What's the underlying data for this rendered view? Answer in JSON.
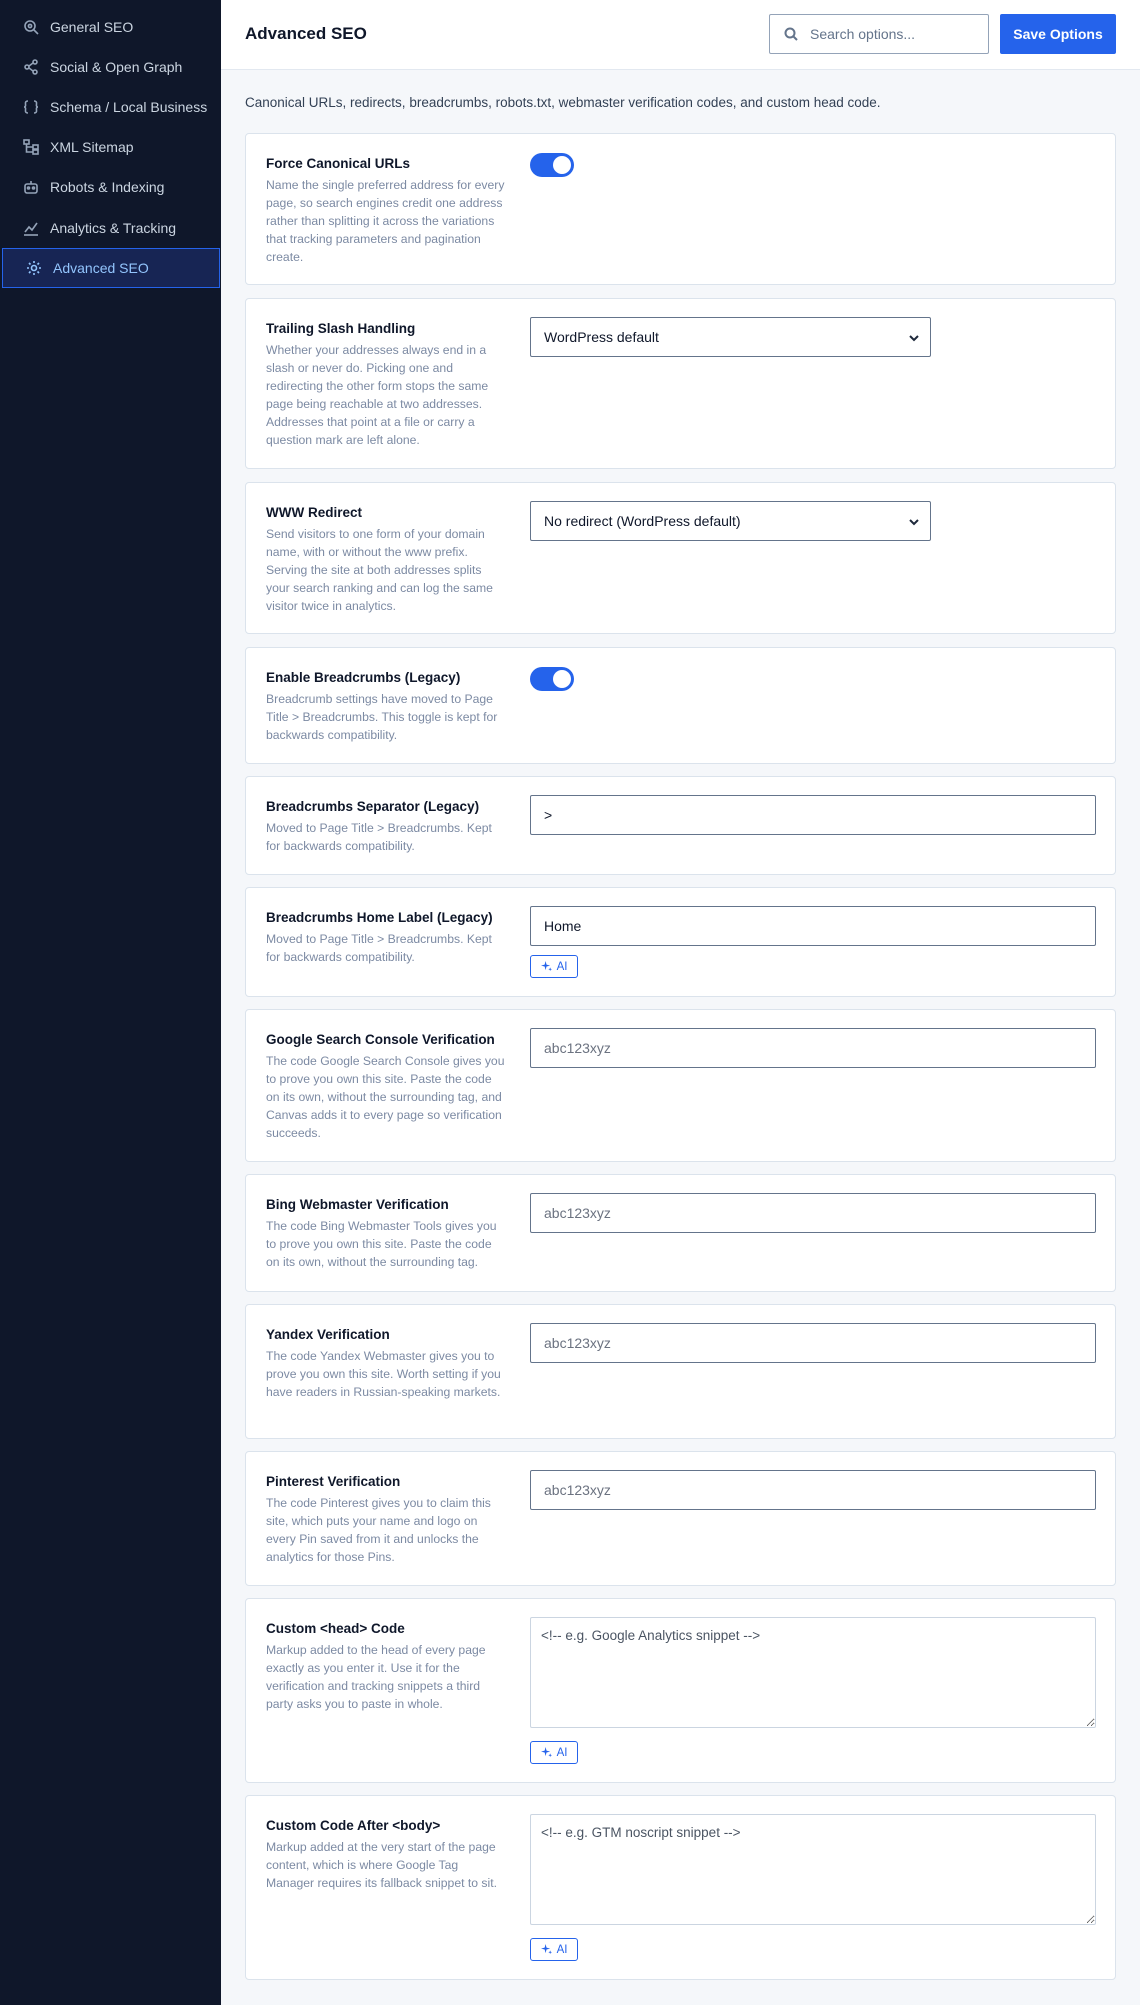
{
  "sidebar": {
    "items": [
      {
        "label": "General SEO",
        "icon": "search-gear-icon"
      },
      {
        "label": "Social & Open Graph",
        "icon": "share-icon"
      },
      {
        "label": "Schema / Local Business",
        "icon": "braces-icon"
      },
      {
        "label": "XML Sitemap",
        "icon": "sitemap-icon"
      },
      {
        "label": "Robots & Indexing",
        "icon": "robot-icon"
      },
      {
        "label": "Analytics & Tracking",
        "icon": "chart-icon"
      },
      {
        "label": "Advanced SEO",
        "icon": "gear-icon",
        "active": true
      }
    ]
  },
  "header": {
    "title": "Advanced SEO",
    "search_placeholder": "Search options...",
    "save_label": "Save Options"
  },
  "intro": "Canonical URLs, redirects, breadcrumbs, robots.txt, webmaster verification codes, and custom head code.",
  "settings": {
    "force_canonical": {
      "label": "Force Canonical URLs",
      "description": "Name the single preferred address for every page, so search engines credit one address rather than splitting it across the variations that tracking parameters and pagination create.",
      "enabled": true
    },
    "trailing_slash": {
      "label": "Trailing Slash Handling",
      "description": "Whether your addresses always end in a slash or never do. Picking one and redirecting the other form stops the same page being reachable at two addresses. Addresses that point at a file or carry a question mark are left alone.",
      "value": "WordPress default"
    },
    "www_redirect": {
      "label": "WWW Redirect",
      "description": "Send visitors to one form of your domain name, with or without the www prefix. Serving the site at both addresses splits your search ranking and can log the same visitor twice in analytics.",
      "value": "No redirect (WordPress default)"
    },
    "breadcrumbs": {
      "label": "Enable Breadcrumbs (Legacy)",
      "description": "Breadcrumb settings have moved to Page Title > Breadcrumbs. This toggle is kept for backwards compatibility.",
      "enabled": true
    },
    "breadcrumbs_separator": {
      "label": "Breadcrumbs Separator (Legacy)",
      "description": "Moved to Page Title > Breadcrumbs. Kept for backwards compatibility.",
      "value": ">"
    },
    "breadcrumbs_home": {
      "label": "Breadcrumbs Home Label (Legacy)",
      "description": "Moved to Page Title > Breadcrumbs. Kept for backwards compatibility.",
      "value": "Home",
      "ai_label": "AI"
    },
    "google_verification": {
      "label": "Google Search Console Verification",
      "description": "The code Google Search Console gives you to prove you own this site. Paste the code on its own, without the surrounding tag, and Canvas adds it to every page so verification succeeds.",
      "placeholder": "abc123xyz"
    },
    "bing_verification": {
      "label": "Bing Webmaster Verification",
      "description": "The code Bing Webmaster Tools gives you to prove you own this site. Paste the code on its own, without the surrounding tag.",
      "placeholder": "abc123xyz"
    },
    "yandex_verification": {
      "label": "Yandex Verification",
      "description": "The code Yandex Webmaster gives you to prove you own this site. Worth setting if you have readers in Russian-speaking markets.",
      "placeholder": "abc123xyz"
    },
    "pinterest_verification": {
      "label": "Pinterest Verification",
      "description": "The code Pinterest gives you to claim this site, which puts your name and logo on every Pin saved from it and unlocks the analytics for those Pins.",
      "placeholder": "abc123xyz"
    },
    "custom_head": {
      "label": "Custom <head> Code",
      "description": "Markup added to the head of every page exactly as you enter it. Use it for the verification and tracking snippets a third party asks you to paste in whole.",
      "placeholder": "<!-- e.g. Google Analytics snippet -->",
      "ai_label": "AI"
    },
    "custom_body": {
      "label": "Custom Code After <body>",
      "description": "Markup added at the very start of the page content, which is where Google Tag Manager requires its fallback snippet to sit.",
      "placeholder": "<!-- e.g. GTM noscript snippet -->",
      "ai_label": "AI"
    }
  },
  "colors": {
    "sidebar_bg": "#0f172a",
    "accent": "#2563eb",
    "active_item_bg": "#172554"
  }
}
